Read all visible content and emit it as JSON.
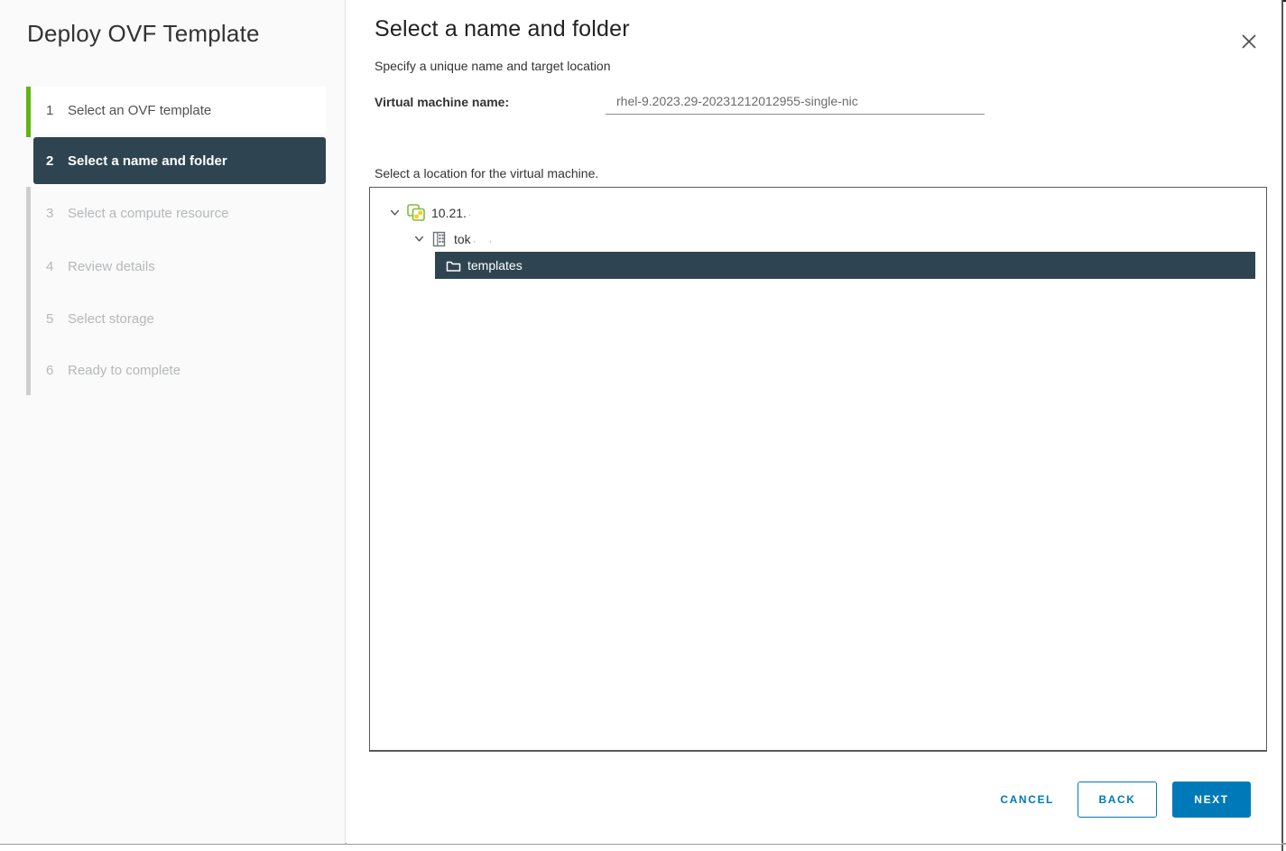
{
  "dialog": {
    "title": "Deploy OVF Template"
  },
  "steps": [
    {
      "number": "1",
      "label": "Select an OVF template",
      "state": "completed"
    },
    {
      "number": "2",
      "label": "Select a name and folder",
      "state": "active"
    },
    {
      "number": "3",
      "label": "Select a compute resource",
      "state": "pending"
    },
    {
      "number": "4",
      "label": "Review details",
      "state": "pending"
    },
    {
      "number": "5",
      "label": "Select storage",
      "state": "pending"
    },
    {
      "number": "6",
      "label": "Ready to complete",
      "state": "pending"
    }
  ],
  "content": {
    "heading": "Select a name and folder",
    "subheading": "Specify a unique name and target location",
    "vm_name_label": "Virtual machine name:",
    "vm_name_value": "rhel-9.2023.29-20231212012955-single-nic",
    "location_label": "Select a location for the virtual machine."
  },
  "tree": {
    "items": [
      {
        "label": "10.21.",
        "suffix": ".",
        "icon": "vcenter-icon",
        "level": 0,
        "expanded": true,
        "selected": false
      },
      {
        "label": "tok",
        "suffix": ", ,",
        "icon": "datacenter-icon",
        "level": 1,
        "expanded": true,
        "selected": false
      },
      {
        "label": "templates",
        "suffix": "",
        "icon": "folder-icon",
        "level": 2,
        "expanded": false,
        "selected": true
      }
    ]
  },
  "footer": {
    "cancel_label": "CANCEL",
    "back_label": "BACK",
    "next_label": "NEXT"
  },
  "colors": {
    "accent_green": "#60b515",
    "selected_dark": "#2e4551",
    "action_blue": "#0079b8",
    "pending_text": "#b5b8ba"
  }
}
